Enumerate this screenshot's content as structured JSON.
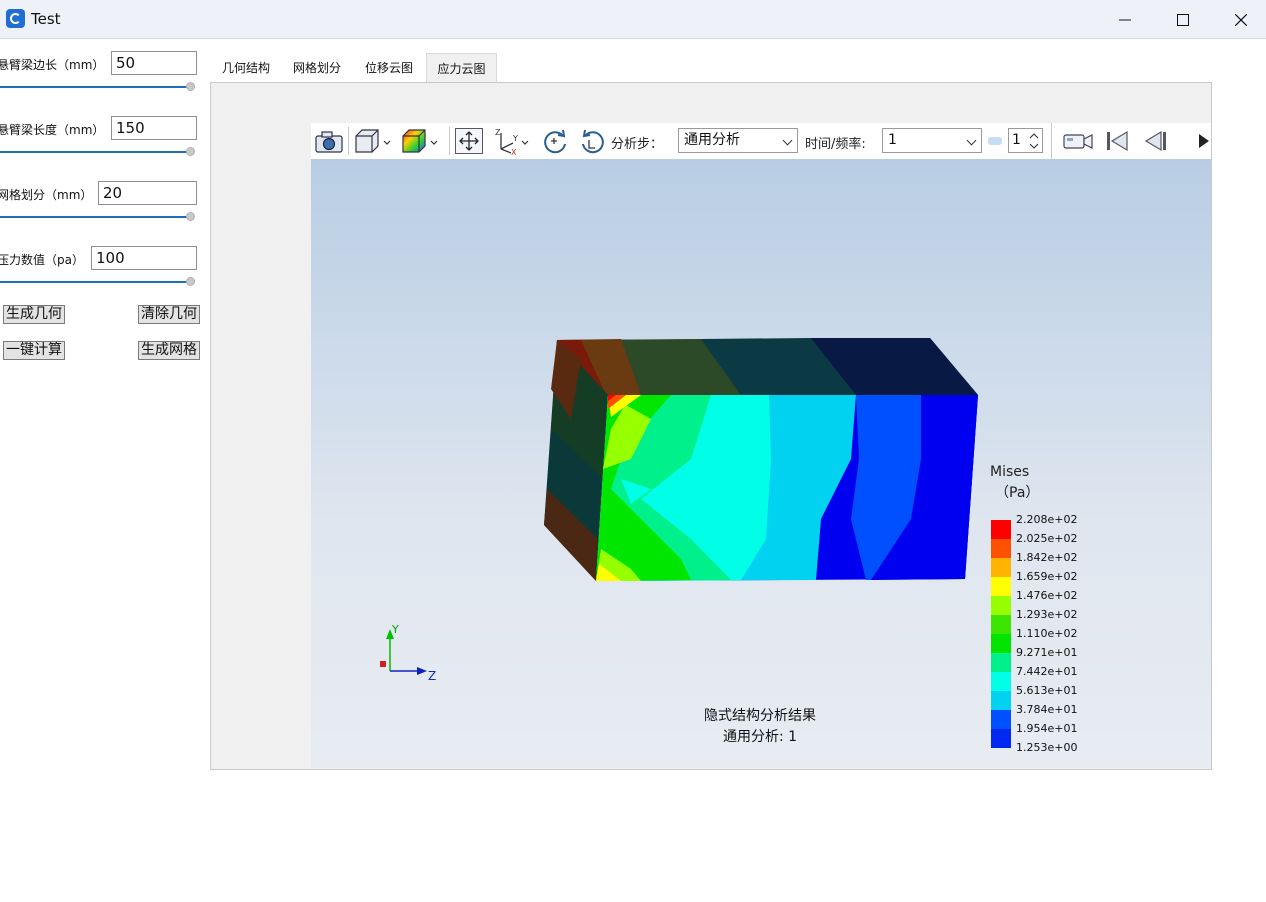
{
  "window": {
    "title": "Test"
  },
  "icons": {
    "app": "app-icon",
    "minimize": "minimize-icon",
    "maximize": "maximize-icon",
    "close": "close-icon"
  },
  "params": [
    {
      "label": "悬臂梁边长（mm）",
      "value": "50"
    },
    {
      "label": "悬臂梁长度（mm）",
      "value": "150"
    },
    {
      "label": "网格划分（mm）",
      "value": "20"
    },
    {
      "label": "压力数值（pa）",
      "value": "100"
    }
  ],
  "buttons": {
    "generate_geometry": "生成几何",
    "clear_geometry": "清除几何",
    "one_click_compute": "一键计算",
    "generate_mesh": "生成网格"
  },
  "tabs": [
    {
      "label": "几何结构",
      "active": false
    },
    {
      "label": "网格划分",
      "active": false
    },
    {
      "label": "位移云图",
      "active": false
    },
    {
      "label": "应力云图",
      "active": true
    }
  ],
  "toolbar": {
    "step_label": "分析步：",
    "step_value": "通用分析",
    "time_label": "时间/频率:",
    "time_value": "1",
    "frame_value": "1"
  },
  "legend": {
    "title": "Mises",
    "unit": "（Pa）",
    "values": [
      "2.208e+02",
      "2.025e+02",
      "1.842e+02",
      "1.659e+02",
      "1.476e+02",
      "1.293e+02",
      "1.110e+02",
      "9.271e+01",
      "7.442e+01",
      "5.613e+01",
      "3.784e+01",
      "1.954e+01",
      "1.253e+00"
    ],
    "colors": [
      "#ff0000",
      "#ff5000",
      "#ffb400",
      "#ffff00",
      "#96ff00",
      "#3ce600",
      "#00e600",
      "#00f08c",
      "#00ffe6",
      "#00d2f0",
      "#0050ff",
      "#0028f0",
      "#0000f0"
    ]
  },
  "axes": {
    "y": "Y",
    "z": "Z"
  },
  "caption": {
    "line1": "隐式结构分析结果",
    "line2": "通用分析: 1"
  }
}
